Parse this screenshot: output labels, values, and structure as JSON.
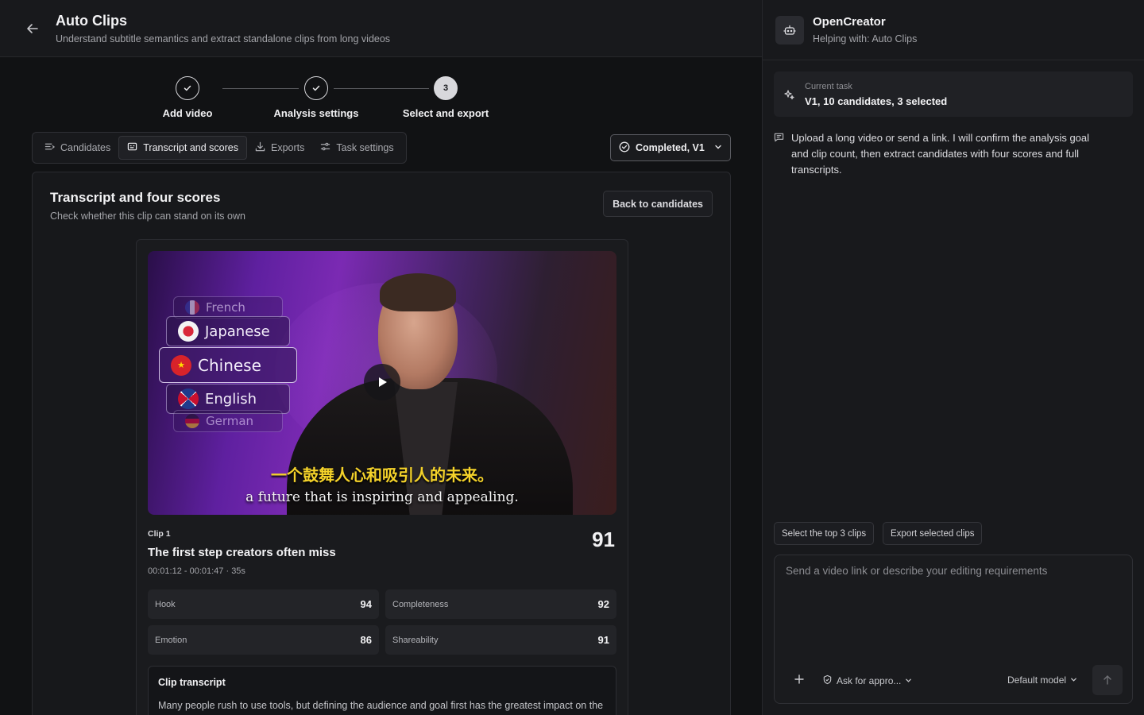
{
  "header": {
    "title": "Auto Clips",
    "subtitle": "Understand subtitle semantics and extract standalone clips from long videos"
  },
  "steps": [
    {
      "label": "Add video",
      "state": "done"
    },
    {
      "label": "Analysis settings",
      "state": "done"
    },
    {
      "label": "Select and export",
      "number": "3",
      "state": "current"
    }
  ],
  "tabs": [
    {
      "label": "Candidates",
      "icon": "list-icon"
    },
    {
      "label": "Transcript and scores",
      "icon": "captions-icon",
      "active": true
    },
    {
      "label": "Exports",
      "icon": "download-icon"
    },
    {
      "label": "Task settings",
      "icon": "sliders-icon"
    }
  ],
  "status": {
    "label": "Completed, V1"
  },
  "panel": {
    "title": "Transcript and four scores",
    "subtitle": "Check whether this clip can stand on its own",
    "back_label": "Back to candidates"
  },
  "clip": {
    "tag": "Clip 1",
    "title": "The first step creators often miss",
    "time": "00:01:12 - 00:01:47 · 35s",
    "score": "91",
    "scores": [
      {
        "name": "Hook",
        "value": "94"
      },
      {
        "name": "Completeness",
        "value": "92"
      },
      {
        "name": "Emotion",
        "value": "86"
      },
      {
        "name": "Shareability",
        "value": "91"
      }
    ],
    "transcript_title": "Clip transcript",
    "transcript_text": "Many people rush to use tools, but defining the audience and goal first has the greatest impact on the result."
  },
  "video": {
    "languages": [
      "French",
      "Japanese",
      "Chinese",
      "English",
      "German"
    ],
    "subtitle_cn": "一个鼓舞人心和吸引人的未来。",
    "subtitle_en": "a future that is inspiring and appealing."
  },
  "assistant": {
    "name": "OpenCreator",
    "helping": "Helping with: Auto Clips",
    "task_label": "Current task",
    "task_value": "V1, 10 candidates, 3 selected",
    "message": "Upload a long video or send a link. I will confirm the analysis goal and clip count, then extract candidates with four scores and full transcripts.",
    "quick_actions": [
      "Select the top 3 clips",
      "Export selected clips"
    ],
    "input_placeholder": "Send a video link or describe your editing requirements",
    "permission_label": "Ask for appro...",
    "model_label": "Default model"
  }
}
